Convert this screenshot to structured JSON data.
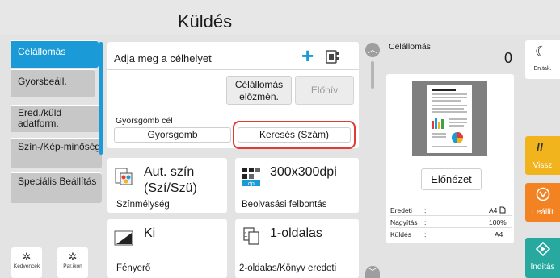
{
  "header": {
    "title": "Küldés"
  },
  "sidebar": {
    "items": [
      {
        "label": "Célállomás"
      },
      {
        "label": "Gyorsbeáll."
      },
      {
        "label": "Ered./küld adatform."
      },
      {
        "label": "Szín-/Kép-minőség"
      },
      {
        "label": "Speciális Beállítás"
      }
    ],
    "bottom": [
      {
        "label": "Kedvencek",
        "icon": "star-gear-icon"
      },
      {
        "label": "Par.ikon",
        "icon": "gear-icon"
      }
    ]
  },
  "destination": {
    "placeholder": "Adja meg a célhelyet",
    "history_label": "Célállomás előzmén.",
    "recall_label": "Előhív",
    "quick_key_caption": "Gyorsgomb cél",
    "quick_key_button": "Gyorsgomb",
    "search_button": "Keresés (Szám)"
  },
  "functions": [
    {
      "value": "Aut. szín (Szí/Szü)",
      "label": "Színmélység",
      "icon": "color-mode-icon"
    },
    {
      "value": "300x300dpi",
      "label": "Beolvasási felbontás",
      "icon": "dpi-icon"
    },
    {
      "value": "Ki",
      "label": "Fényerő",
      "icon": "brightness-icon"
    },
    {
      "value": "1-oldalas",
      "label": "2-oldalas/Könyv eredeti",
      "icon": "duplex-icon"
    }
  ],
  "preview_panel": {
    "title": "Célállomás",
    "count": "0",
    "preview_button": "Előnézet",
    "rows": [
      {
        "key": "Eredeti",
        "sep": ":",
        "value": "A4"
      },
      {
        "key": "Nagyítás",
        "sep": ":",
        "value": "100%"
      },
      {
        "key": "Küldés",
        "sep": ":",
        "value": "A4"
      }
    ]
  },
  "right_buttons": {
    "sleep": "En.tak.",
    "back": "Vissz",
    "stop": "Leállít",
    "start": "Indítás"
  },
  "colors": {
    "accent": "#1a9ad6",
    "back": "#f2b41d",
    "stop": "#f28222",
    "start": "#27a9a0",
    "highlight": "#e53935"
  }
}
